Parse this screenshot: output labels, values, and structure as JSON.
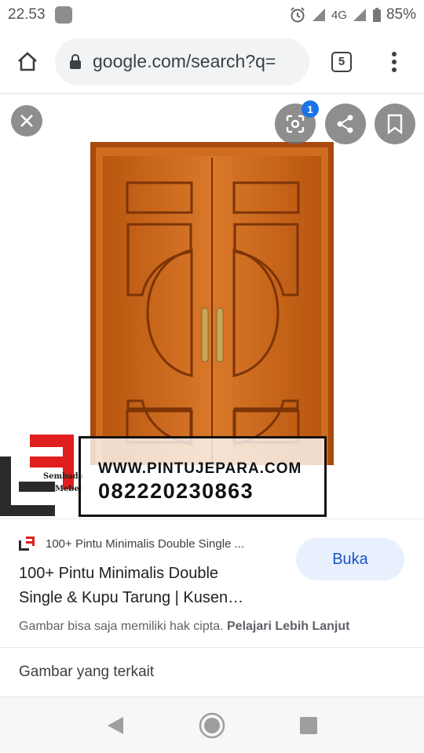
{
  "status_bar": {
    "time": "22.53",
    "network": "4G",
    "battery": "85%",
    "icons": [
      "notification-icon",
      "alarm-icon",
      "signal-icon",
      "battery-icon"
    ]
  },
  "browser": {
    "url": "google.com/search?q=",
    "tab_count": "5",
    "icons": [
      "home-icon",
      "lock-icon",
      "tabs-icon",
      "more-vert-icon"
    ]
  },
  "viewer": {
    "lens_badge": "1",
    "icons": [
      "close-icon",
      "lens-icon",
      "share-icon",
      "bookmark-icon"
    ],
    "watermark": {
      "url": "WWW.PINTUJEPARA.COM",
      "phone": "082220230863",
      "logo_line1": "Sembada",
      "logo_line2": "Mebel"
    }
  },
  "result": {
    "site_name": "100+ Pintu Minimalis Double Single ...",
    "title_line1": "100+ Pintu Minimalis Double",
    "title_line2": "Single & Kupu Tarung | Kusen…",
    "open_button": "Buka",
    "copyright_text": "Gambar bisa saja memiliki hak cipta.",
    "learn_more": "Pelajari Lebih Lanjut"
  },
  "related": {
    "label": "Gambar yang terkait"
  },
  "nav": {
    "icons": [
      "back-icon",
      "home-nav-icon",
      "recents-icon"
    ]
  },
  "colors": {
    "accent": "#1a73e8",
    "open_button_bg": "#e8f0fe",
    "door_wood": "#c8661c",
    "logo_red": "#e01e1e"
  }
}
